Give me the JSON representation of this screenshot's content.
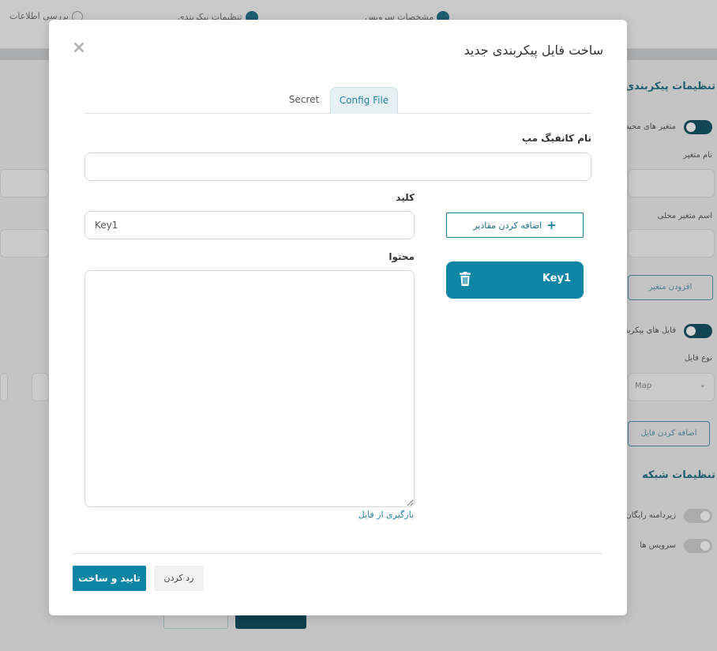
{
  "background": {
    "steps": [
      "مشخصات سرویس",
      "تنظیمات پیکربندی",
      "بررسی اطلاعات"
    ],
    "section_config": "تنظیمات پیکربندی",
    "env_vars_label": "متغیر های محیطی",
    "var_name_label": "نام متغیر",
    "local_var_label": "اسم متغیر محلی",
    "add_var_btn": "افزودن متغیر",
    "config_files_label": "فایل های پیکربندی",
    "file_type_label": "نوع فایل",
    "file_type_value": "Map",
    "add_file_btn": "اضافه کردن فایل",
    "section_network": "تنظیمات شبکه",
    "network_row1": "زیردامنه رایگان",
    "network_row2": "سرویس ها"
  },
  "modal": {
    "title": "ساخت فایل پیکربندی جدید",
    "tabs": [
      {
        "label": "Config File",
        "active": true
      },
      {
        "label": "Secret",
        "active": false
      }
    ],
    "configmap_name_label": "نام کانفیگ مپ",
    "configmap_name_value": "",
    "key_label": "کلید",
    "key_value": "Key1",
    "content_label": "محتوا",
    "content_value": "",
    "upload_link": "بارگیری از فایل",
    "add_values_button": "اضافه کردن مقادیر",
    "key_items": [
      {
        "label": "Key1"
      }
    ],
    "confirm_button": "تایید و ساخت",
    "cancel_button": "رد کردن"
  },
  "colors": {
    "primary": "#0f85a5",
    "primary_dark": "#1f6f86",
    "tab_active_bg": "#e5f1f5"
  }
}
